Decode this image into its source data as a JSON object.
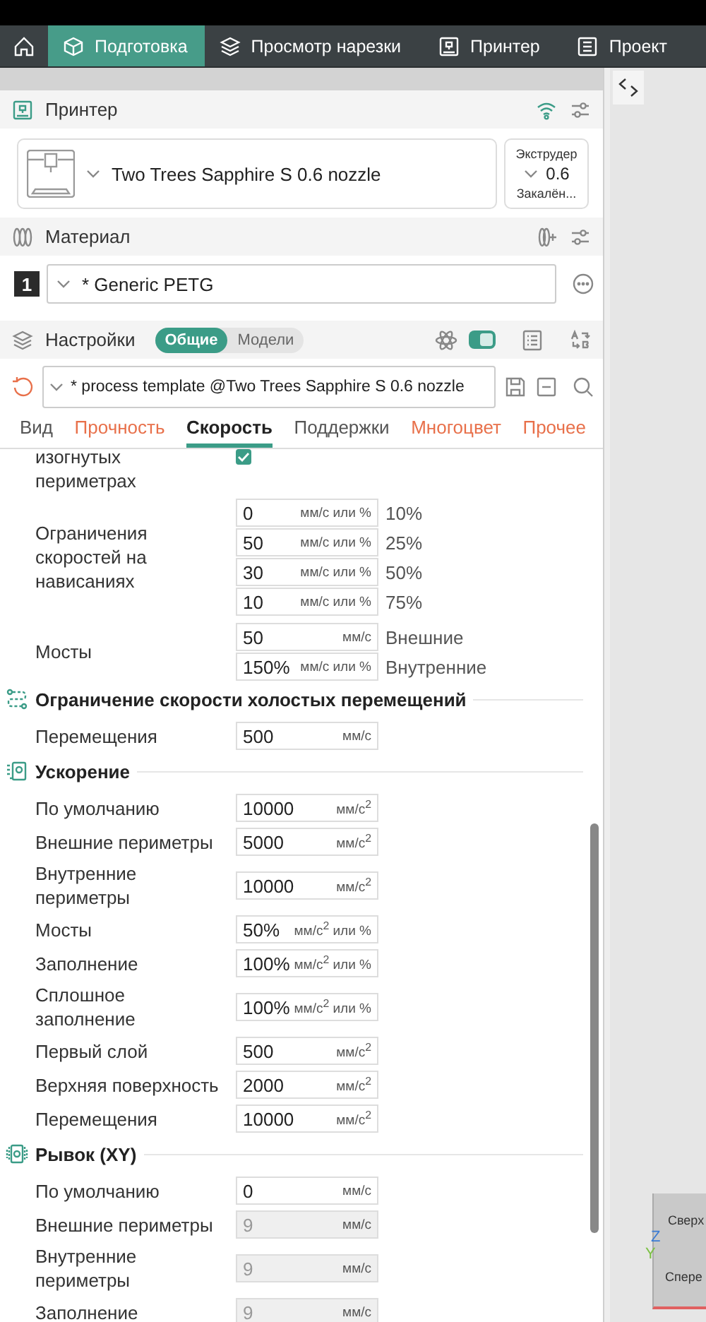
{
  "nav": {
    "tabs": [
      {
        "label": "Подготовка",
        "selected": true
      },
      {
        "label": "Просмотр нарезки",
        "selected": false
      },
      {
        "label": "Принтер",
        "selected": false
      },
      {
        "label": "Проект",
        "selected": false
      }
    ]
  },
  "printer": {
    "title": "Принтер",
    "name": "Two Trees Sapphire S 0.6 nozzle",
    "extruder": {
      "label": "Экструдер",
      "value": "0.6",
      "type": "Закалён..."
    }
  },
  "material": {
    "title": "Материал",
    "slot": "1",
    "filament": "* Generic PETG"
  },
  "settings": {
    "title": "Настройки",
    "modes": [
      {
        "label": "Общие",
        "selected": true
      },
      {
        "label": "Модели",
        "selected": false
      }
    ],
    "advanced": true,
    "preset": "* process template @Two Trees Sapphire S 0.6 nozzle",
    "tabs": [
      {
        "label": "Вид",
        "selected": false,
        "modified": false
      },
      {
        "label": "Прочность",
        "selected": false,
        "modified": true
      },
      {
        "label": "Скорость",
        "selected": true,
        "modified": false
      },
      {
        "label": "Поддержки",
        "selected": false,
        "modified": false
      },
      {
        "label": "Многоцвет",
        "selected": false,
        "modified": true
      },
      {
        "label": "Прочее",
        "selected": false,
        "modified": true
      }
    ]
  },
  "groups": [
    {
      "rows": [
        {
          "label": "изогнутых\nпериметрах",
          "kind": "checkbox",
          "checked": true
        },
        {
          "label": "Ограничения\nскоростей на\nнависаниях",
          "kind": "fields",
          "fields": [
            {
              "value": "0",
              "unit": "мм/с или %",
              "note": "10%",
              "disabled": false
            },
            {
              "value": "50",
              "unit": "мм/с или %",
              "note": "25%",
              "disabled": false
            },
            {
              "value": "30",
              "unit": "мм/с или %",
              "note": "50%",
              "disabled": false
            },
            {
              "value": "10",
              "unit": "мм/с или %",
              "note": "75%",
              "disabled": false
            }
          ]
        },
        {
          "label": "Мосты",
          "kind": "fields",
          "fields": [
            {
              "value": "50",
              "unit": "мм/с",
              "note": "Внешние",
              "disabled": false
            },
            {
              "value": "150%",
              "unit": "мм/с или %",
              "note": "Внутренние",
              "disabled": false
            }
          ]
        }
      ]
    },
    {
      "title": "Ограничение скорости холостых перемещений",
      "rows": [
        {
          "label": "Перемещения",
          "kind": "fields",
          "fields": [
            {
              "value": "500",
              "unit": "мм/с",
              "disabled": false
            }
          ]
        }
      ]
    },
    {
      "title": "Ускорение",
      "rows": [
        {
          "label": "По умолчанию",
          "kind": "fields",
          "fields": [
            {
              "value": "10000",
              "unit": "мм/с$^{2}$",
              "disabled": false
            }
          ]
        },
        {
          "label": "Внешние периметры",
          "kind": "fields",
          "fields": [
            {
              "value": "5000",
              "unit": "мм/с$^{2}$",
              "disabled": false
            }
          ]
        },
        {
          "label": "Внутренние\nпериметры",
          "kind": "fields",
          "fields": [
            {
              "value": "10000",
              "unit": "мм/с$^{2}$",
              "disabled": false
            }
          ]
        },
        {
          "label": "Мосты",
          "kind": "fields",
          "fields": [
            {
              "value": "50%",
              "unit": "мм/с$^{2}$ или %",
              "disabled": false
            }
          ]
        },
        {
          "label": "Заполнение",
          "kind": "fields",
          "fields": [
            {
              "value": "100%",
              "unit": "мм/с$^{2}$ или %",
              "disabled": false
            }
          ]
        },
        {
          "label": "Сплошное\nзаполнение",
          "kind": "fields",
          "fields": [
            {
              "value": "100%",
              "unit": "мм/с$^{2}$ или %",
              "disabled": false
            }
          ]
        },
        {
          "label": "Первый слой",
          "kind": "fields",
          "fields": [
            {
              "value": "500",
              "unit": "мм/с$^{2}$",
              "disabled": false
            }
          ]
        },
        {
          "label": "Верхняя поверхность",
          "kind": "fields",
          "fields": [
            {
              "value": "2000",
              "unit": "мм/с$^{2}$",
              "disabled": false
            }
          ]
        },
        {
          "label": "Перемещения",
          "kind": "fields",
          "fields": [
            {
              "value": "10000",
              "unit": "мм/с$^{2}$",
              "disabled": false
            }
          ]
        }
      ]
    },
    {
      "title": "Рывок (XY)",
      "rows": [
        {
          "label": "По умолчанию",
          "kind": "fields",
          "fields": [
            {
              "value": "0",
              "unit": "мм/с",
              "disabled": false
            }
          ]
        },
        {
          "label": "Внешние периметры",
          "kind": "fields",
          "fields": [
            {
              "value": "9",
              "unit": "мм/с",
              "disabled": true
            }
          ]
        },
        {
          "label": "Внутренние\nпериметры",
          "kind": "fields",
          "fields": [
            {
              "value": "9",
              "unit": "мм/с",
              "disabled": true
            }
          ]
        },
        {
          "label": "Заполнение",
          "kind": "fields",
          "fields": [
            {
              "value": "9",
              "unit": "мм/с",
              "disabled": true
            }
          ]
        }
      ]
    }
  ],
  "viewport": {
    "faces": [
      "Сверх",
      "Спере"
    ],
    "axes": [
      "Z",
      "Y"
    ]
  }
}
